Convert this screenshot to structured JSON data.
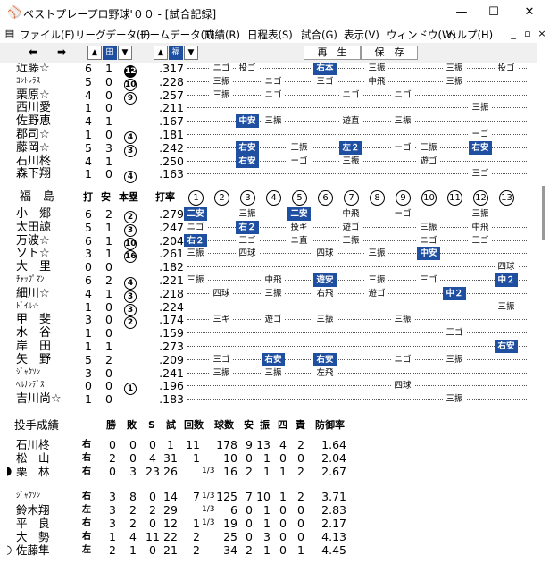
{
  "window": {
    "title": "ベストプレープロ野球'００ - [試合記録]",
    "app_icon": "baseball-app-icon"
  },
  "menu": [
    "ファイル(F)",
    "リーグデータ(L)",
    "チームデータ(T)",
    "成績(R)",
    "日程表(S)",
    "試合(G)",
    "表示(V)",
    "ウィンドウ(W)",
    "ヘルプ(H)"
  ],
  "toolbar": {
    "team1": "田",
    "team2": "福",
    "play_label": "再　生",
    "save_label": "保　存"
  },
  "home_tail": [
    {
      "name": "近藤☆",
      "ab": "6",
      "h": "1",
      "hr": "12",
      "hr_filled": true,
      "avg": ".317",
      "abs": [
        {
          "i": 2,
          "t": "ニゴ"
        },
        {
          "i": 3,
          "t": "投ゴ"
        },
        {
          "i": 6,
          "t": "右本",
          "hit": true
        },
        {
          "i": 8,
          "t": "三振"
        },
        {
          "i": 11,
          "t": "三振"
        },
        {
          "i": 13,
          "t": "投ゴ"
        }
      ]
    },
    {
      "name": "ｺﾝﾄﾚﾗｽ",
      "small": true,
      "ab": "5",
      "h": "0",
      "hr": "10",
      "avg": ".228",
      "abs": [
        {
          "i": 2,
          "t": "三振"
        },
        {
          "i": 4,
          "t": "ニゴ"
        },
        {
          "i": 6,
          "t": "三ゴ"
        },
        {
          "i": 8,
          "t": "中飛"
        },
        {
          "i": 11,
          "t": "三振"
        }
      ]
    },
    {
      "name": "栗原☆",
      "ab": "4",
      "h": "0",
      "hr": "9",
      "avg": ".257",
      "abs": [
        {
          "i": 2,
          "t": "三振"
        },
        {
          "i": 4,
          "t": "ニゴ"
        },
        {
          "i": 7,
          "t": "ニゴ"
        },
        {
          "i": 9,
          "t": "ニゴ"
        }
      ]
    },
    {
      "name": "西川愛",
      "ab": "1",
      "h": "0",
      "hr": "",
      "avg": ".211",
      "abs": [
        {
          "i": 12,
          "t": "三振"
        }
      ]
    },
    {
      "name": "佐野恵",
      "ab": "4",
      "h": "1",
      "hr": "",
      "avg": ".167",
      "abs": [
        {
          "i": 3,
          "t": "中安",
          "hit": true
        },
        {
          "i": 4,
          "t": "三振"
        },
        {
          "i": 7,
          "t": "遊直"
        },
        {
          "i": 9,
          "t": "三振"
        }
      ]
    },
    {
      "name": "郡司☆",
      "ab": "1",
      "h": "0",
      "hr": "4",
      "avg": ".181",
      "abs": [
        {
          "i": 12,
          "t": "ーゴ"
        }
      ]
    },
    {
      "name": "藤岡☆",
      "ab": "5",
      "h": "3",
      "hr": "3",
      "avg": ".242",
      "abs": [
        {
          "i": 3,
          "t": "右安",
          "hit": true
        },
        {
          "i": 5,
          "t": "三振"
        },
        {
          "i": 7,
          "t": "左２",
          "hit": true
        },
        {
          "i": 9,
          "t": "ーゴ"
        },
        {
          "i": 10,
          "t": "三振"
        },
        {
          "i": 12,
          "t": "右安",
          "hit": true
        }
      ]
    },
    {
      "name": "石川柊",
      "ab": "4",
      "h": "1",
      "hr": "",
      "avg": ".250",
      "abs": [
        {
          "i": 3,
          "t": "右安",
          "hit": true
        },
        {
          "i": 5,
          "t": "ーゴ"
        },
        {
          "i": 7,
          "t": "三振"
        },
        {
          "i": 10,
          "t": "遊ゴ"
        }
      ]
    },
    {
      "name": "森下翔",
      "ab": "1",
      "h": "0",
      "hr": "4",
      "avg": ".163",
      "abs": [
        {
          "i": 12,
          "t": "三ゴ"
        }
      ]
    }
  ],
  "away_header": {
    "team": "福　島",
    "ab": "打",
    "h": "安",
    "hr": "本塁",
    "avg": "打率",
    "innings": [
      "1",
      "2",
      "3",
      "4",
      "5",
      "6",
      "7",
      "8",
      "9",
      "10",
      "11",
      "12",
      "13"
    ]
  },
  "away": [
    {
      "name": "小　郷",
      "ab": "6",
      "h": "2",
      "hr": "2",
      "avg": ".279",
      "abs": [
        {
          "i": 1,
          "t": "二安",
          "hit": true
        },
        {
          "i": 3,
          "t": "三振"
        },
        {
          "i": 5,
          "t": "二安",
          "hit": true
        },
        {
          "i": 7,
          "t": "中飛"
        },
        {
          "i": 9,
          "t": "ーゴ"
        },
        {
          "i": 12,
          "t": "三振"
        }
      ]
    },
    {
      "name": "太田諒",
      "ab": "5",
      "h": "1",
      "hr": "3",
      "avg": ".247",
      "abs": [
        {
          "i": 1,
          "t": "ニゴ"
        },
        {
          "i": 3,
          "t": "右２",
          "hit": true
        },
        {
          "i": 5,
          "t": "投ギ"
        },
        {
          "i": 7,
          "t": "遊ゴ"
        },
        {
          "i": 10,
          "t": "三振"
        },
        {
          "i": 12,
          "t": "中飛"
        }
      ]
    },
    {
      "name": "万波☆",
      "ab": "6",
      "h": "1",
      "hr": "10",
      "avg": ".204",
      "abs": [
        {
          "i": 1,
          "t": "右２",
          "hit": true
        },
        {
          "i": 3,
          "t": "三ゴ"
        },
        {
          "i": 5,
          "t": "ニ直"
        },
        {
          "i": 7,
          "t": "三振"
        },
        {
          "i": 10,
          "t": "ニゴ"
        },
        {
          "i": 12,
          "t": "三ゴ"
        }
      ]
    },
    {
      "name": "ソト☆",
      "ab": "3",
      "h": "1",
      "hr": "16",
      "avg": ".261",
      "abs": [
        {
          "i": 1,
          "t": "三振"
        },
        {
          "i": 3,
          "t": "四球"
        },
        {
          "i": 6,
          "t": "四球"
        },
        {
          "i": 8,
          "t": "三振"
        },
        {
          "i": 10,
          "t": "中安",
          "hit": true
        }
      ]
    },
    {
      "name": "大　里",
      "ab": "0",
      "h": "0",
      "hr": "",
      "avg": ".182",
      "abs": [
        {
          "i": 13,
          "t": "四球"
        }
      ]
    },
    {
      "name": "ﾁｬｯﾌﾟﾏﾝ",
      "small": true,
      "ab": "6",
      "h": "2",
      "hr": "4",
      "avg": ".221",
      "abs": [
        {
          "i": 1,
          "t": "三振"
        },
        {
          "i": 4,
          "t": "中飛"
        },
        {
          "i": 6,
          "t": "遊安",
          "hit": true
        },
        {
          "i": 8,
          "t": "三振"
        },
        {
          "i": 10,
          "t": "三ゴ"
        },
        {
          "i": 13,
          "t": "中２",
          "hit": true
        }
      ]
    },
    {
      "name": "細川☆",
      "ab": "4",
      "h": "1",
      "hr": "3",
      "avg": ".218",
      "abs": [
        {
          "i": 2,
          "t": "四球"
        },
        {
          "i": 4,
          "t": "三振"
        },
        {
          "i": 6,
          "t": "右飛"
        },
        {
          "i": 8,
          "t": "遊ゴ"
        },
        {
          "i": 11,
          "t": "中２",
          "hit": true
        }
      ]
    },
    {
      "name": "ﾄﾞｲﾙ☆",
      "small": true,
      "ab": "1",
      "h": "0",
      "hr": "3",
      "avg": ".224",
      "abs": [
        {
          "i": 13,
          "t": "三振"
        }
      ]
    },
    {
      "name": "甲　斐",
      "ab": "3",
      "h": "0",
      "hr": "2",
      "avg": ".174",
      "abs": [
        {
          "i": 2,
          "t": "三ギ"
        },
        {
          "i": 4,
          "t": "遊ゴ"
        },
        {
          "i": 6,
          "t": "三振"
        },
        {
          "i": 9,
          "t": "三振"
        }
      ]
    },
    {
      "name": "水　谷",
      "ab": "1",
      "h": "0",
      "hr": "",
      "avg": ".159",
      "abs": [
        {
          "i": 11,
          "t": "三ゴ"
        }
      ]
    },
    {
      "name": "岸　田",
      "ab": "1",
      "h": "1",
      "hr": "",
      "avg": ".273",
      "abs": [
        {
          "i": 13,
          "t": "右安",
          "hit": true
        }
      ]
    },
    {
      "name": "矢　野",
      "ab": "5",
      "h": "2",
      "hr": "",
      "avg": ".209",
      "abs": [
        {
          "i": 2,
          "t": "三ゴ"
        },
        {
          "i": 4,
          "t": "右安",
          "hit": true
        },
        {
          "i": 6,
          "t": "右安",
          "hit": true
        },
        {
          "i": 9,
          "t": "ニゴ"
        },
        {
          "i": 11,
          "t": "三振"
        }
      ]
    },
    {
      "name": "ｼﾞｬｸｿﾝ",
      "small": true,
      "ab": "3",
      "h": "0",
      "hr": "",
      "avg": ".241",
      "abs": [
        {
          "i": 2,
          "t": "三振"
        },
        {
          "i": 4,
          "t": "三振"
        },
        {
          "i": 6,
          "t": "左飛"
        }
      ]
    },
    {
      "name": "ﾍﾙﾅﾝﾃﾞｽ",
      "small": true,
      "ab": "0",
      "h": "0",
      "hr": "1",
      "avg": ".196",
      "abs": [
        {
          "i": 9,
          "t": "四球"
        }
      ]
    },
    {
      "name": "吉川尚☆",
      "ab": "1",
      "h": "0",
      "hr": "",
      "avg": ".183",
      "abs": [
        {
          "i": 11,
          "t": "三振"
        }
      ]
    }
  ],
  "pitch_header": {
    "title": "投手成績",
    "w": "勝",
    "l": "敗",
    "s": "S",
    "g": "試",
    "ip": "回数",
    "bf": "球数",
    "h": "安",
    "k": "振",
    "bb": "四",
    "er": "責",
    "era": "防御率"
  },
  "pitchers_home": [
    {
      "mark": "",
      "name": "石川柊",
      "hand": "右",
      "w": "0",
      "l": "0",
      "s": "0",
      "g": "1",
      "ip": "11",
      "frac": "",
      "bf": "178",
      "h": "9",
      "k": "13",
      "bb": "4",
      "er": "2",
      "era": "1.64"
    },
    {
      "mark": "",
      "name": "松　山",
      "hand": "右",
      "w": "2",
      "l": "0",
      "s": "4",
      "g": "31",
      "ip": "1",
      "frac": "",
      "bf": "10",
      "h": "0",
      "k": "1",
      "bb": "0",
      "er": "0",
      "era": "2.04"
    },
    {
      "mark": "●",
      "name": "栗　林",
      "hand": "右",
      "w": "0",
      "l": "3",
      "s": "23",
      "g": "26",
      "ip": "",
      "frac": "1/3",
      "bf": "16",
      "h": "2",
      "k": "1",
      "bb": "1",
      "er": "2",
      "era": "2.67"
    }
  ],
  "pitchers_away": [
    {
      "mark": "",
      "name": "ｼﾞｬｸｿﾝ",
      "small": true,
      "hand": "右",
      "w": "3",
      "l": "8",
      "s": "0",
      "g": "14",
      "ip": "7",
      "frac": "1/3",
      "bf": "125",
      "h": "7",
      "k": "10",
      "bb": "1",
      "er": "2",
      "era": "3.71"
    },
    {
      "mark": "",
      "name": "鈴木翔",
      "hand": "左",
      "w": "3",
      "l": "2",
      "s": "2",
      "g": "29",
      "ip": "",
      "frac": "1/3",
      "bf": "6",
      "h": "0",
      "k": "1",
      "bb": "0",
      "er": "0",
      "era": "2.83"
    },
    {
      "mark": "",
      "name": "平　良",
      "hand": "右",
      "w": "3",
      "l": "2",
      "s": "0",
      "g": "12",
      "ip": "1",
      "frac": "1/3",
      "bf": "19",
      "h": "0",
      "k": "1",
      "bb": "0",
      "er": "0",
      "era": "2.17"
    },
    {
      "mark": "",
      "name": "大　勢",
      "hand": "右",
      "w": "1",
      "l": "4",
      "s": "11",
      "g": "22",
      "ip": "2",
      "frac": "",
      "bf": "25",
      "h": "0",
      "k": "3",
      "bb": "0",
      "er": "0",
      "era": "4.13"
    },
    {
      "mark": "○",
      "name": "佐藤隼",
      "hand": "左",
      "w": "2",
      "l": "1",
      "s": "0",
      "g": "21",
      "ip": "2",
      "frac": "",
      "bf": "34",
      "h": "2",
      "k": "1",
      "bb": "0",
      "er": "1",
      "era": "4.45"
    }
  ]
}
